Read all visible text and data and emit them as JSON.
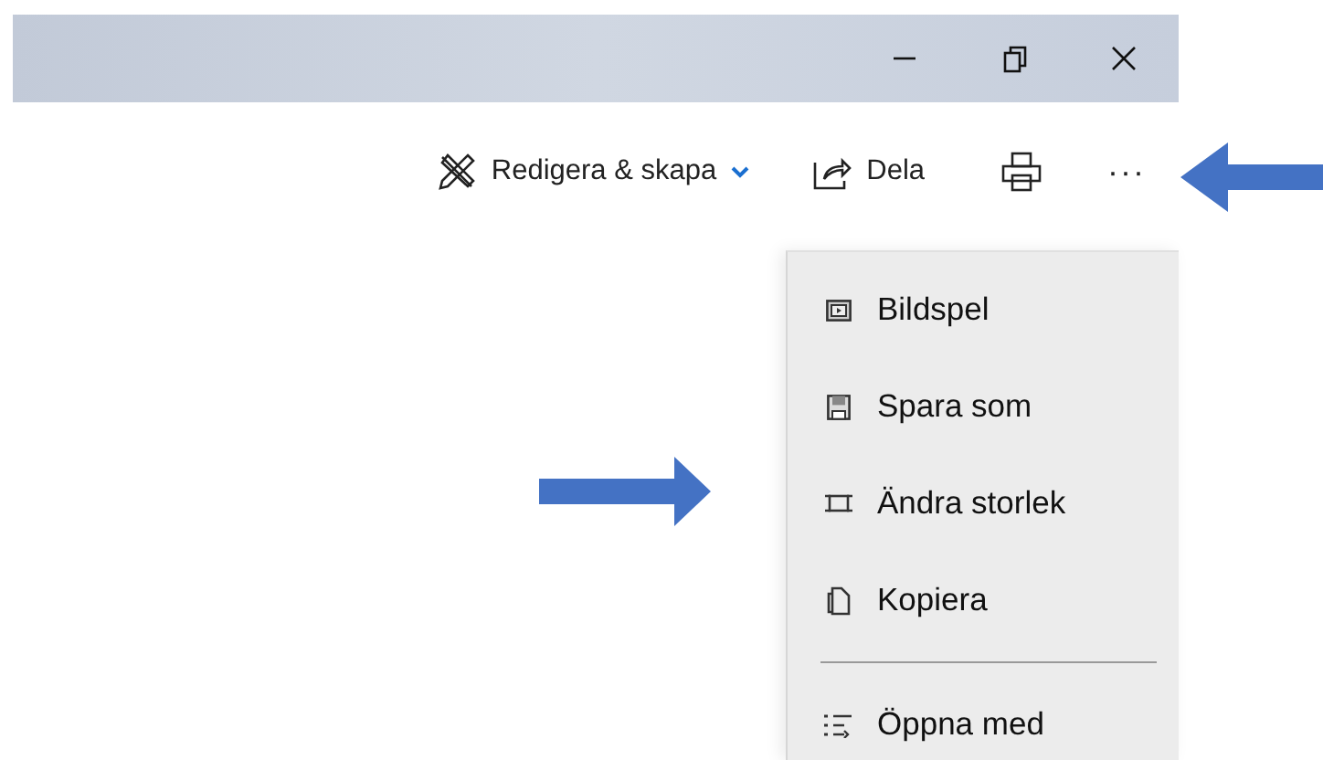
{
  "window": {
    "controls": [
      {
        "kind": "minimize"
      },
      {
        "kind": "restore"
      },
      {
        "kind": "close"
      }
    ]
  },
  "toolbar": [
    {
      "kind": "menu-button",
      "label": "Redigera & skapa"
    },
    {
      "kind": "button",
      "label": "Dela"
    },
    {
      "kind": "print"
    },
    {
      "kind": "more",
      "label": "···"
    }
  ],
  "menu": [
    {
      "kind": "item",
      "label": "Bildspel"
    },
    {
      "kind": "item",
      "label": "Spara som"
    },
    {
      "kind": "item",
      "label": "Ändra storlek"
    },
    {
      "kind": "item",
      "label": "Kopiera"
    },
    {
      "kind": "separator"
    },
    {
      "kind": "item",
      "label": "Öppna med"
    }
  ]
}
